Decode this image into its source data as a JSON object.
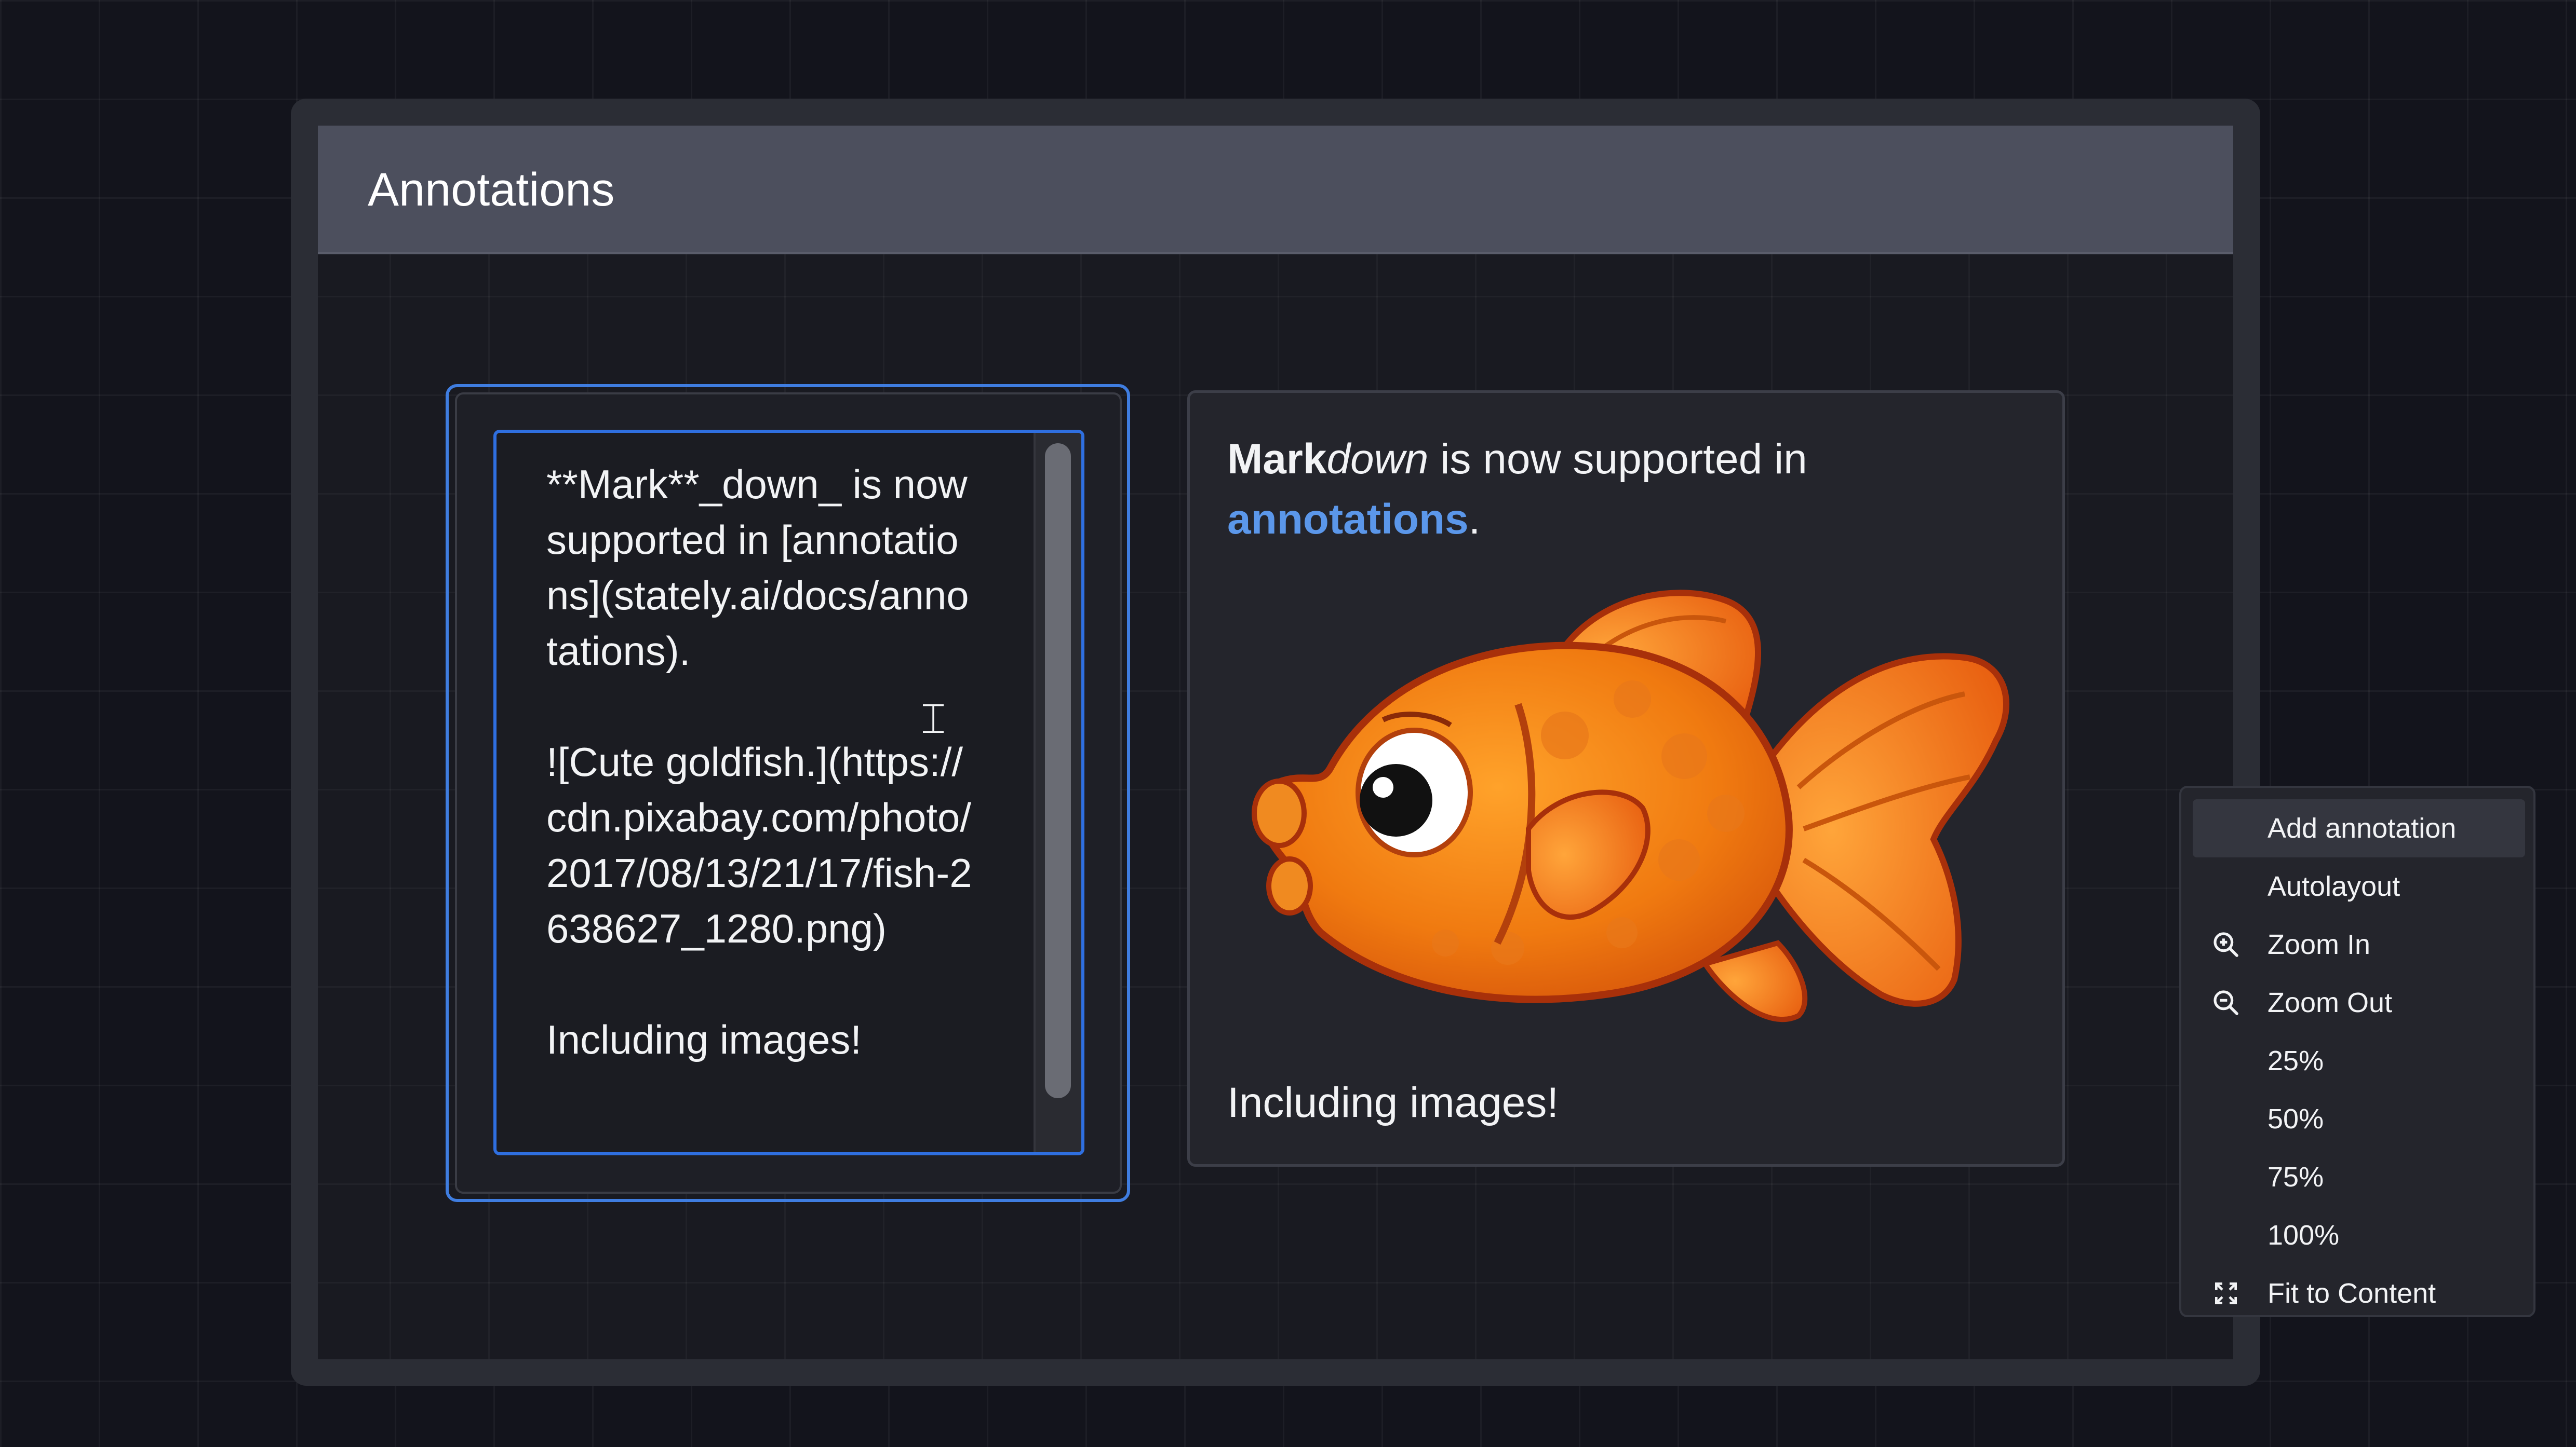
{
  "state": {
    "title": "Annotations"
  },
  "editor": {
    "text": "**Mark**_down_ is now supported in [annotations](stately.ai/docs/annotations).\n\n![Cute goldfish.](https://cdn.pixabay.com/photo/2017/08/13/21/17/fish-2638627_1280.png)\n\nIncluding images!"
  },
  "preview": {
    "bold": "Mark",
    "italic": "down",
    "middle": " is now supported in ",
    "link": "annotations",
    "end": ".",
    "caption": "Including images!",
    "image_icon": "goldfish-image"
  },
  "context_menu": {
    "items": [
      {
        "label": "Add annotation",
        "icon": ""
      },
      {
        "label": "Autolayout",
        "icon": ""
      },
      {
        "label": "Zoom In",
        "icon": "zoom-in-icon"
      },
      {
        "label": "Zoom Out",
        "icon": "zoom-out-icon"
      },
      {
        "label": "25%",
        "icon": ""
      },
      {
        "label": "50%",
        "icon": ""
      },
      {
        "label": "75%",
        "icon": ""
      },
      {
        "label": "100%",
        "icon": ""
      },
      {
        "label": "Fit to Content",
        "icon": "fit-to-content-icon"
      }
    ]
  },
  "colors": {
    "accent": "#3f7de0",
    "link": "#5b97ea",
    "header": "#4c4f5d",
    "background": "#13141c"
  }
}
